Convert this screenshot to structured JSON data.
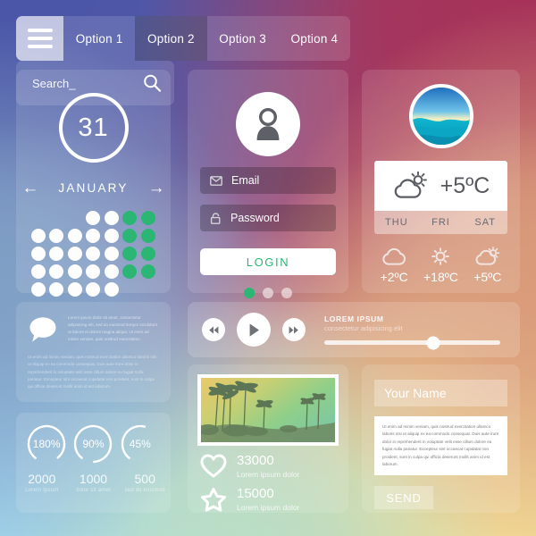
{
  "nav": {
    "menu_icon": "hamburger-icon",
    "tabs": [
      {
        "label": "Option 1",
        "active": false
      },
      {
        "label": "Option 2",
        "active": true
      },
      {
        "label": "Option 3",
        "active": false
      },
      {
        "label": "Option 4",
        "active": false
      }
    ]
  },
  "search": {
    "value": "Search_",
    "placeholder": "Search_",
    "icon": "search-icon"
  },
  "calendar": {
    "day": "31",
    "month": "JANUARY",
    "prev_icon": "arrow-left-icon",
    "next_icon": "arrow-right-icon",
    "dot_colors": {
      "white": "#fdfdfd",
      "green": "#2bb673"
    },
    "grid": [
      [
        "e",
        "e",
        "e",
        "w",
        "w",
        "g",
        "g"
      ],
      [
        "w",
        "w",
        "w",
        "w",
        "w",
        "g",
        "g"
      ],
      [
        "w",
        "w",
        "w",
        "w",
        "w",
        "g",
        "g"
      ],
      [
        "w",
        "w",
        "w",
        "w",
        "w",
        "g",
        "g"
      ],
      [
        "w",
        "w",
        "w",
        "w",
        "w",
        "e",
        "e"
      ]
    ]
  },
  "login": {
    "avatar_icon": "user-avatar-icon",
    "email": {
      "icon": "envelope-icon",
      "label": "Email"
    },
    "password": {
      "icon": "lock-icon",
      "label": "Password"
    },
    "button_label": "LOGIN",
    "button_color": "#2bb673",
    "pager_dots": [
      true,
      false,
      false
    ]
  },
  "weather": {
    "avatar_icon": "ocean-photo-avatar",
    "current": {
      "icon": "sun-cloud-icon",
      "temp": "+5ºC"
    },
    "days": [
      "THU",
      "FRI",
      "SAT"
    ],
    "forecast": [
      {
        "icon": "cloud-icon",
        "temp": "+2ºC"
      },
      {
        "icon": "sun-icon",
        "temp": "+18ºC"
      },
      {
        "icon": "sun-cloud-icon",
        "temp": "+5ºC"
      }
    ]
  },
  "chat": {
    "icon": "speech-bubble-icon",
    "excerpt": "Lorem ipsum dolor sit amet, consectetur adipisicing elit, sed do eiusmod tempor incididunt ut labore et dolore magna aliqua. Ut enim ad minim veniam, quis nostrud exercitation.",
    "body": "Ut enim ad minim veniam, quis nostrud exercitation ullamco laboris nisi ut aliquip ex ea commodo consequat. Duis aute irure dolor in reprehenderit in voluptate velit esse cillum dolore eu fugiat nulla pariatur. Excepteur sint occaecat cupidatat non proident, sunt in culpa qui officia deserunt mollit anim id est laborum."
  },
  "player": {
    "prev_icon": "rewind-icon",
    "play_icon": "play-icon",
    "next_icon": "fast-forward-icon",
    "title": "LOREM IPSUM",
    "subtitle": "consectetur adipisicing elit",
    "progress_percent": 62
  },
  "stats": {
    "gauges": [
      {
        "percent_label": "180%",
        "arc_percent": 80,
        "number": "2000",
        "caption": "Lorem Ipsum"
      },
      {
        "percent_label": "90%",
        "arc_percent": 90,
        "number": "1000",
        "caption": "dolor sit amet"
      },
      {
        "percent_label": "45%",
        "arc_percent": 45,
        "number": "500",
        "caption": "sed do eiusmod"
      }
    ]
  },
  "photo_card": {
    "image_alt": "palm-trees-sunset-photo",
    "rows": [
      {
        "icon": "heart-icon",
        "value": "33000",
        "label": "Lorem ipsum dolor"
      },
      {
        "icon": "star-icon",
        "value": "15000",
        "label": "Lorem ipsum dolor"
      }
    ]
  },
  "contact_form": {
    "name_value": "Your Name",
    "name_placeholder": "Your Name",
    "message": "Ut enim ad minim veniam, quis nostrud exercitation ullamco laboris nisi ut aliquip ex ea commodo consequat. Duis aute irure dolor in reprehenderit in voluptate velit esse cillum dolore eu fugiat nulla pariatur. Excepteur sint occaecat cupidatat non proident, sunt in culpa qui officia deserunt mollit anim id est laborum.",
    "send_label": "SEND"
  },
  "theme": {
    "accent_green": "#2bb673",
    "bg_top_left": "#4b56a8",
    "bg_top_right": "#a63259",
    "bg_bottom_left": "#a0d6f3",
    "bg_bottom_right": "#f1da96"
  }
}
